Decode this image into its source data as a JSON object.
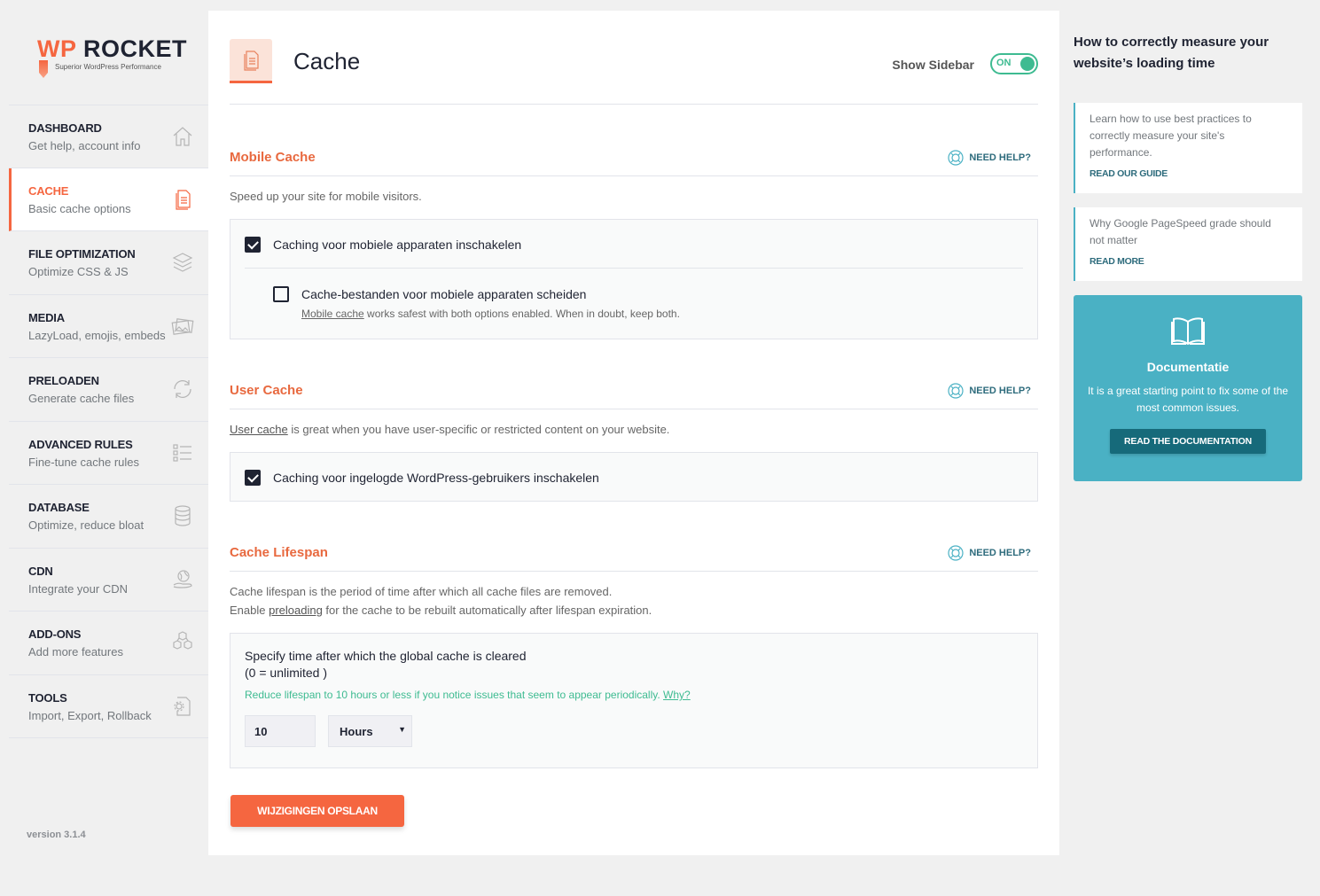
{
  "logo": {
    "wp": "WP",
    "rocket": "ROCKET",
    "tagline": "Superior WordPress Performance"
  },
  "nav": {
    "items": [
      {
        "title": "DASHBOARD",
        "subtitle": "Get help, account info",
        "icon": "home-icon",
        "active": false
      },
      {
        "title": "CACHE",
        "subtitle": "Basic cache options",
        "icon": "document-icon",
        "active": true
      },
      {
        "title": "FILE OPTIMIZATION",
        "subtitle": "Optimize CSS & JS",
        "icon": "layers-icon",
        "active": false
      },
      {
        "title": "MEDIA",
        "subtitle": "LazyLoad, emojis, embeds",
        "icon": "images-icon",
        "active": false
      },
      {
        "title": "PRELOADEN",
        "subtitle": "Generate cache files",
        "icon": "refresh-icon",
        "active": false
      },
      {
        "title": "ADVANCED RULES",
        "subtitle": "Fine-tune cache rules",
        "icon": "checklist-icon",
        "active": false
      },
      {
        "title": "DATABASE",
        "subtitle": "Optimize, reduce bloat",
        "icon": "database-icon",
        "active": false
      },
      {
        "title": "CDN",
        "subtitle": "Integrate your CDN",
        "icon": "globe-hand-icon",
        "active": false
      },
      {
        "title": "ADD-ONS",
        "subtitle": "Add more features",
        "icon": "cubes-icon",
        "active": false
      },
      {
        "title": "TOOLS",
        "subtitle": "Import, Export, Rollback",
        "icon": "file-gear-icon",
        "active": false
      }
    ],
    "version": "version 3.1.4"
  },
  "header": {
    "title": "Cache",
    "show_sidebar_label": "Show Sidebar",
    "toggle_state": "ON"
  },
  "sections": {
    "mobile": {
      "title": "Mobile Cache",
      "help": "NEED HELP?",
      "description": "Speed up your site for mobile visitors.",
      "option1": {
        "label": "Caching voor mobiele apparaten inschakelen",
        "checked": true
      },
      "option2": {
        "label": "Cache-bestanden voor mobiele apparaten scheiden",
        "checked": false
      },
      "note_link": "Mobile cache",
      "note_rest": " works safest with both options enabled. When in doubt, keep both."
    },
    "user": {
      "title": "User Cache",
      "help": "NEED HELP?",
      "desc_link": "User cache",
      "desc_rest": " is great when you have user-specific or restricted content on your website.",
      "option1": {
        "label": "Caching voor ingelogde WordPress-gebruikers inschakelen",
        "checked": true
      }
    },
    "lifespan": {
      "title": "Cache Lifespan",
      "help": "NEED HELP?",
      "desc_line1": "Cache lifespan is the period of time after which all cache files are removed.",
      "desc_line2_pre": "Enable ",
      "desc_line2_link": "preloading",
      "desc_line2_post": " for the cache to be rebuilt automatically after lifespan expiration.",
      "field_label": "Specify time after which the global cache is cleared",
      "field_sublabel": "(0 = unlimited )",
      "warning": "Reduce lifespan to 10 hours or less if you notice issues that seem to appear periodically. ",
      "warning_link": "Why?",
      "value": "10",
      "unit": "Hours"
    }
  },
  "save_button": "WIJZIGINGEN OPSLAAN",
  "aside": {
    "title": "How to correctly measure your website’s loading time",
    "tips": [
      {
        "text": "Learn how to use best practices to correctly measure your site's performance.",
        "link": "READ OUR GUIDE"
      },
      {
        "text": "Why Google PageSpeed grade should not matter",
        "link": "READ MORE"
      }
    ],
    "doc": {
      "title": "Documentatie",
      "text": "It is a great starting point to fix some of the most common issues.",
      "button": "READ THE DOCUMENTATION"
    }
  },
  "colors": {
    "accent": "#f56640",
    "teal": "#4ab1c4",
    "green": "#3ebb91",
    "dark": "#1f2332"
  }
}
